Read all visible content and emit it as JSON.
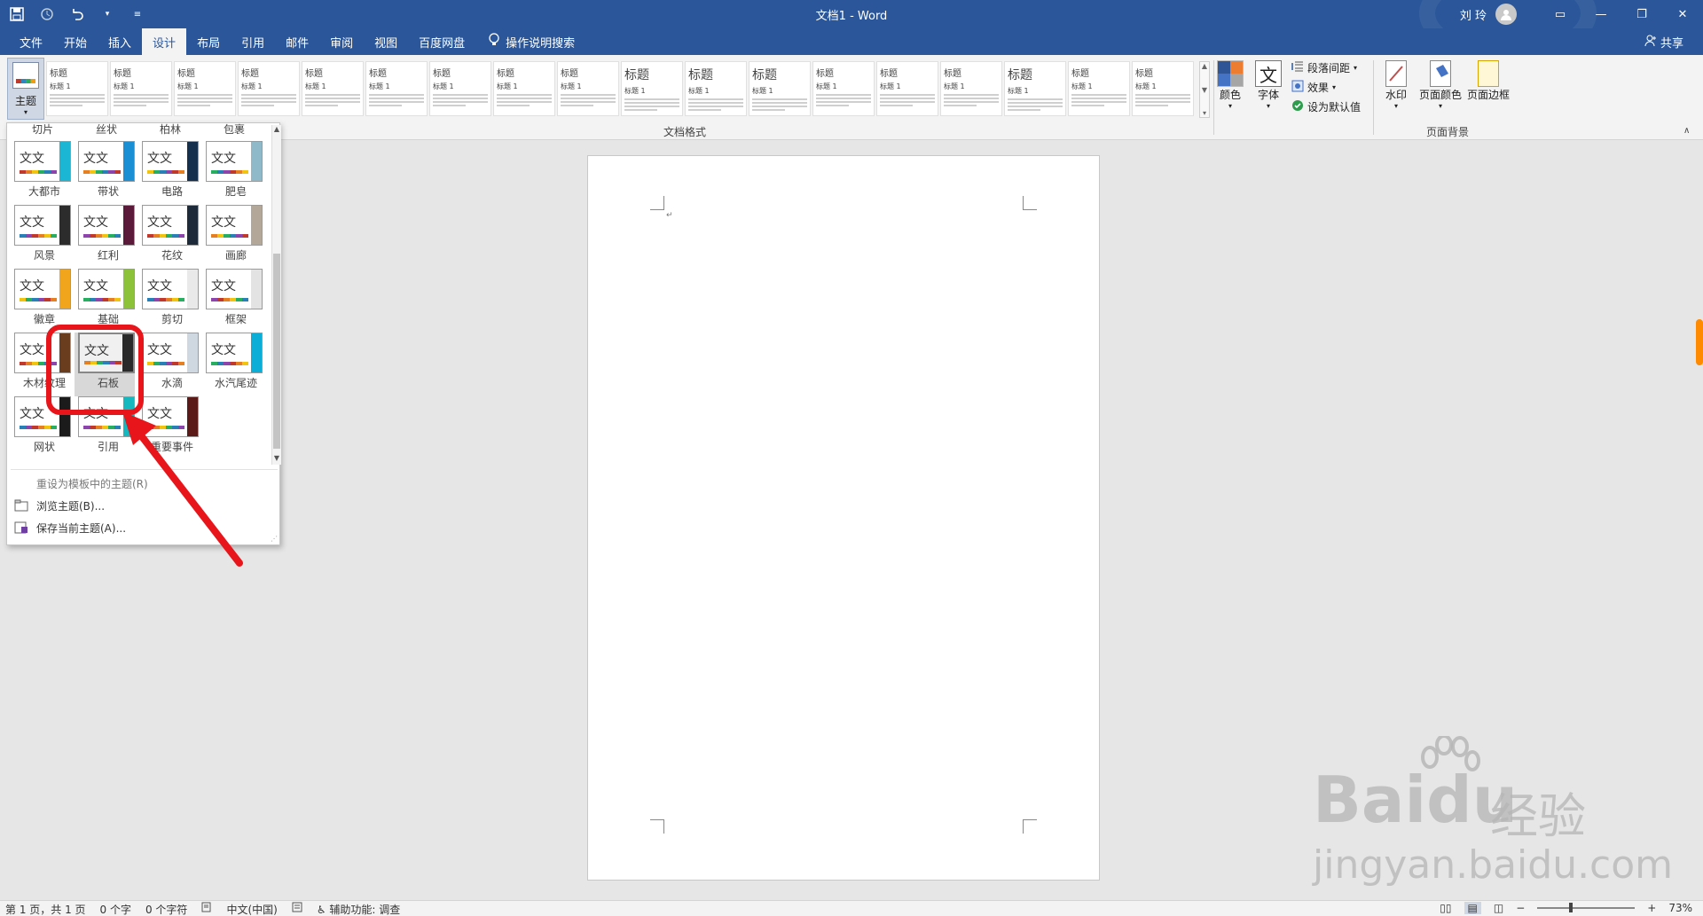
{
  "title_bar": {
    "doc_title": "文档1  -  Word",
    "user_name": "刘 玲"
  },
  "tabs": [
    "文件",
    "开始",
    "插入",
    "设计",
    "布局",
    "引用",
    "邮件",
    "审阅",
    "视图",
    "百度网盘"
  ],
  "active_tab": "设计",
  "tell_me": "操作说明搜索",
  "share": "共享",
  "ribbon": {
    "theme_button": "主题",
    "style_headings": [
      "标题",
      "标题",
      "标题",
      "标题",
      "标题",
      "标题",
      "标题",
      "标题",
      "标题",
      "标题",
      "标题",
      "标题",
      "标题",
      "标题",
      "标题",
      "标题",
      "标题",
      "标题"
    ],
    "style_sub_headings": [
      "标题 1",
      "标题 1",
      "标题 1",
      "标题 1",
      "标题 1",
      "标题 1",
      "标题 1",
      "标题 1",
      "标题 1",
      "标题 1",
      "标题 1",
      "标题 1",
      "标题 1",
      "标题 1",
      "标题 1",
      "标题 1",
      "标题 1",
      "标题 1"
    ],
    "doc_format_group": "文档格式",
    "colors_btn": "颜色",
    "fonts_btn": "字体",
    "font_icon_glyph": "文",
    "paragraph_spacing": "段落间距",
    "effects": "效果",
    "set_default": "设为默认值",
    "watermark_btn": "水印",
    "page_color_btn": "页面颜色",
    "page_borders_btn": "页面边框",
    "page_background_group": "页面背景"
  },
  "theme_dropdown": {
    "partial_row": [
      "切片",
      "丝状",
      "柏林",
      "包裹"
    ],
    "themes": [
      {
        "name": "大都市",
        "text": "文文",
        "side": "#1ab6d4"
      },
      {
        "name": "带状",
        "text": "文文",
        "side": "#1a8fd4"
      },
      {
        "name": "电路",
        "text": "文文",
        "side": "#15304f"
      },
      {
        "name": "肥皂",
        "text": "文文",
        "side": "#8fb8c8"
      },
      {
        "name": "风景",
        "text": "文文",
        "side": "#2c2c2c"
      },
      {
        "name": "红利",
        "text": "文文",
        "side": "#5b1a3a"
      },
      {
        "name": "花纹",
        "text": "文文",
        "side": "#1c2a3a"
      },
      {
        "name": "画廊",
        "text": "文文",
        "side": "#b3a79a"
      },
      {
        "name": "徽章",
        "text": "文文",
        "side": "#f0a51c"
      },
      {
        "name": "基础",
        "text": "文文",
        "side": "#8cc23a"
      },
      {
        "name": "剪切",
        "text": "文文",
        "side": "#e9e9e9"
      },
      {
        "name": "框架",
        "text": "文文",
        "side": "#e3e3e3"
      },
      {
        "name": "木材纹理",
        "text": "文文",
        "side": "#6b3d1f"
      },
      {
        "name": "石板",
        "text": "文文",
        "side": "#2a2a2a"
      },
      {
        "name": "水滴",
        "text": "文文",
        "side": "#cfd8e0"
      },
      {
        "name": "水汽尾迹",
        "text": "文文",
        "side": "#0aaed6"
      },
      {
        "name": "网状",
        "text": "文文",
        "side": "#1b1b1b"
      },
      {
        "name": "引用",
        "text": "文文",
        "side": "#16b8c0"
      },
      {
        "name": "重要事件",
        "text": "文文",
        "side": "#5b1a18"
      }
    ],
    "selected": "石板",
    "menu": {
      "reset": "重设为模板中的主题(R)",
      "browse": "浏览主题(B)...",
      "save": "保存当前主题(A)..."
    }
  },
  "status_bar": {
    "page": "第 1 页，共 1 页",
    "words": "0 个字",
    "chars": "0 个字符",
    "language": "中文(中国)",
    "accessibility": "辅助功能: 调查",
    "zoom": "73%"
  },
  "watermark": {
    "brand": "Bai",
    "brand2": "du",
    "cn": "经验",
    "url": "jingyan.baidu.com"
  },
  "colors": {
    "accent": "#2b579a",
    "highlight": "#e8151b"
  }
}
